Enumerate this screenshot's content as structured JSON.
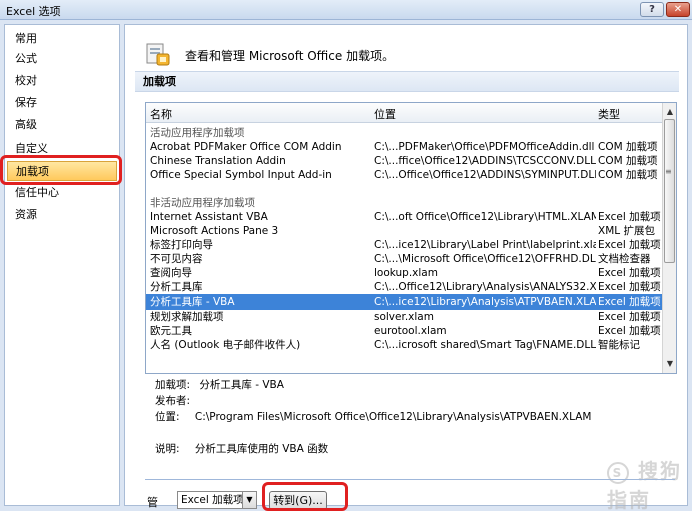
{
  "window": {
    "title": "Excel 选项",
    "help_glyph": "?",
    "close_glyph": "✕"
  },
  "sidebar": {
    "items": [
      {
        "label": "常用"
      },
      {
        "label": "公式"
      },
      {
        "label": "校对"
      },
      {
        "label": "保存"
      },
      {
        "label": "高级"
      },
      {
        "label": "自定义"
      },
      {
        "label": "加载项"
      },
      {
        "label": "信任中心"
      },
      {
        "label": "资源"
      }
    ],
    "active_index": 6
  },
  "header": {
    "text": "查看和管理 Microsoft Office 加载项。",
    "icon": "addin-icon"
  },
  "section": {
    "title": "加载项"
  },
  "list": {
    "columns": [
      "名称",
      "位置",
      "类型"
    ],
    "rows": [
      {
        "name": "活动应用程序加载项",
        "location": "",
        "type": "",
        "group": true
      },
      {
        "name": "Acrobat PDFMaker Office COM Addin",
        "location": "C:\\...PDFMaker\\Office\\PDFMOfficeAddin.dll",
        "type": "COM 加载项"
      },
      {
        "name": "Chinese Translation Addin",
        "location": "C:\\...ffice\\Office12\\ADDINS\\TCSCCONV.DLL",
        "type": "COM 加载项"
      },
      {
        "name": "Office Special Symbol Input Add-in",
        "location": "C:\\...Office\\Office12\\ADDINS\\SYMINPUT.DLL",
        "type": "COM 加载项"
      },
      {
        "name": "",
        "location": "",
        "type": ""
      },
      {
        "name": "非活动应用程序加载项",
        "location": "",
        "type": "",
        "group": true
      },
      {
        "name": "Internet Assistant VBA",
        "location": "C:\\...oft Office\\Office12\\Library\\HTML.XLAM",
        "type": "Excel 加载项"
      },
      {
        "name": "Microsoft Actions Pane 3",
        "location": "",
        "type": "XML 扩展包"
      },
      {
        "name": "标签打印向导",
        "location": "C:\\...ice12\\Library\\Label Print\\labelprint.xlam",
        "type": "Excel 加载项"
      },
      {
        "name": "不可见内容",
        "location": "C:\\...\\Microsoft Office\\Office12\\OFFRHD.DLL",
        "type": "文档检查器"
      },
      {
        "name": "查阅向导",
        "location": "lookup.xlam",
        "type": "Excel 加载项"
      },
      {
        "name": "分析工具库",
        "location": "C:\\...Office12\\Library\\Analysis\\ANALYS32.XLL",
        "type": "Excel 加载项"
      },
      {
        "name": "分析工具库 - VBA",
        "location": "C:\\...ice12\\Library\\Analysis\\ATPVBAEN.XLAM",
        "type": "Excel 加载项",
        "selected": true
      },
      {
        "name": "规划求解加载项",
        "location": "solver.xlam",
        "type": "Excel 加载项"
      },
      {
        "name": "欧元工具",
        "location": "eurotool.xlam",
        "type": "Excel 加载项"
      },
      {
        "name": "人名 (Outlook 电子邮件收件人)",
        "location": "C:\\...icrosoft shared\\Smart Tag\\FNAME.DLL",
        "type": "智能标记"
      }
    ]
  },
  "details": {
    "addin_label": "加载项:",
    "addin_value": "分析工具库 - VBA",
    "publisher_label": "发布者:",
    "publisher_value": "",
    "location_label": "位置:",
    "location_value": "C:\\Program Files\\Microsoft Office\\Office12\\Library\\Analysis\\ATPVBAEN.XLAM",
    "desc_label": "说明:",
    "desc_value": "分析工具库使用的 VBA 函数"
  },
  "manage": {
    "label": "管理:",
    "selected": "Excel 加载项",
    "go_button": "转到(G)..."
  },
  "watermark": {
    "text": "搜狗指南",
    "mark": "S"
  },
  "colors": {
    "selection": "#3d83d8",
    "highlight_oval": "#e02020",
    "active_nav": "#ffc95c"
  }
}
